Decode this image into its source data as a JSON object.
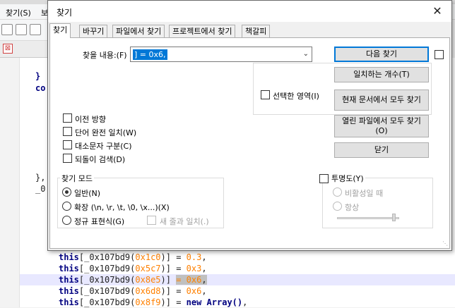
{
  "editor": {
    "menu_search": "찾기(S)",
    "menu_next": "보",
    "tab_close": "⊠",
    "code_lines": [
      {
        "indent": "    ",
        "text": "}"
      },
      {
        "indent": "    ",
        "text": "co"
      },
      {
        "indent": "    ",
        "text": "},"
      },
      {
        "indent": "    ",
        "text": "_0"
      }
    ],
    "bottom_lines": [
      {
        "pre": "this",
        "mid": "[_0x107bd9(",
        "arg": "0x1c0",
        "post": ")] = ",
        "val": "0.3",
        "end": ","
      },
      {
        "pre": "this",
        "mid": "[_0x107bd9(",
        "arg": "0x5c7",
        "post": ")] = ",
        "val": "0x3",
        "end": ","
      },
      {
        "pre": "this",
        "mid": "[_0x107bd9(",
        "arg": "0x8e5",
        "post": ")] ",
        "val": "= 0x6",
        "end": ","
      },
      {
        "pre": "this",
        "mid": "[_0x107bd9(",
        "arg": "0x6d8",
        "post": ")] = ",
        "val": "0x6",
        "end": ","
      },
      {
        "pre": "this",
        "mid": "[_0x107bd9(",
        "arg": "0x8f9",
        "post": ")] = ",
        "val": "new Array()",
        "end": ","
      }
    ]
  },
  "dialog": {
    "title": "찾기",
    "close": "✕",
    "tabs": [
      "찾기",
      "바꾸기",
      "파일에서 찾기",
      "프로젝트에서 찾기",
      "책갈피"
    ],
    "find_label": "찾을 내용:(F)",
    "find_value": "] = 0x6,",
    "buttons": {
      "find_next": "다음 찾기",
      "count": "일치하는 개수(T)",
      "find_all_current": "현재 문서에서 모두 찾기",
      "find_all_open_1": "열린 파일에서 모두 찾기",
      "find_all_open_2": "(O)",
      "close": "닫기"
    },
    "in_selection": "선택한 영역(I)",
    "options": [
      "이전 방향",
      "단어 완전 일치(W)",
      "대소문자 구분(C)",
      "되돌이 검색(D)"
    ],
    "search_mode": {
      "title": "찾기 모드",
      "options": [
        "일반(N)",
        "확장 (\\n, \\r, \\t, \\0, \\x...)(X)",
        "정규 표현식(G)"
      ],
      "selected": 0,
      "newline_match": "새 줄과 일치(.)"
    },
    "transparency": {
      "title": "투명도(Y)",
      "on_lose_focus": "비활성일 때",
      "always": "항상"
    }
  },
  "colors": {
    "selection": "#0078d7",
    "keyword": "#000080",
    "number": "#ff8000"
  }
}
